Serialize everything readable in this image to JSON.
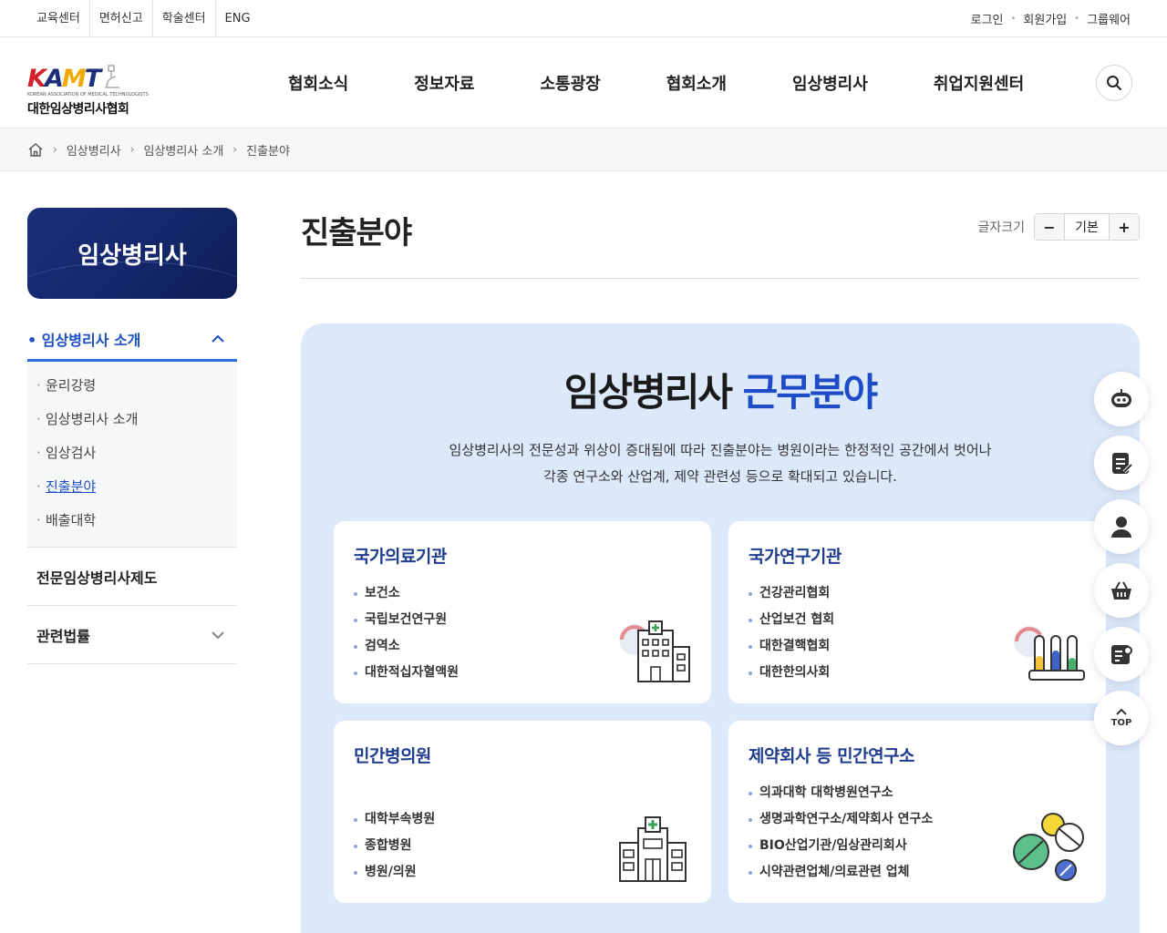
{
  "topbar": {
    "links": [
      "교육센터",
      "면허신고",
      "학술센터",
      "ENG"
    ],
    "right": [
      "로그인",
      "회원가입",
      "그룹웨어"
    ]
  },
  "logo": {
    "mark": "KAMT",
    "sub": "KOREAN ASSOCIATION OF MEDICAL TECHNOLOGISTS",
    "name": "대한임상병리사협회"
  },
  "gnb": [
    "협회소식",
    "정보자료",
    "소통광장",
    "협회소개",
    "임상병리사",
    "취업지원센터"
  ],
  "breadcrumb": [
    "임상병리사",
    "임상병리사 소개",
    "진출분야"
  ],
  "side": {
    "title": "임상병리사",
    "active": "임상병리사 소개",
    "sub": [
      "윤리강령",
      "임상병리사 소개",
      "임상검사",
      "진출분야",
      "배출대학"
    ],
    "items": [
      "전문임상병리사제도",
      "관련법률"
    ]
  },
  "main": {
    "title": "진출분야",
    "fontsize": {
      "label": "글자크기",
      "minus": "−",
      "default": "기본",
      "plus": "+"
    },
    "head_black": "임상병리사",
    "head_blue": "근무분야",
    "desc1": "임상병리사의 전문성과 위상이 증대됨에 따라 진출분야는 병원이라는 한정적인 공간에서 벗어나",
    "desc2": "각종 연구소와 산업계, 제약 관련성 등으로 확대되고 있습니다."
  },
  "cards": [
    {
      "title": "국가의료기관",
      "items": [
        "보건소",
        "국립보건연구원",
        "검역소",
        "대한적십자혈액원"
      ]
    },
    {
      "title": "국가연구기관",
      "items": [
        "건강관리협회",
        "산업보건 협회",
        "대한결핵협회",
        "대한한의사회"
      ]
    },
    {
      "title": "민간병의원",
      "items": [
        "대학부속병원",
        "종합병원",
        "병원/의원"
      ]
    },
    {
      "title": "제약회사 등 민간연구소",
      "items": [
        "의과대학 대학병원연구소",
        "생명과학연구소/제약회사 연구소",
        "BIO산업기관/임상관리회사",
        "시약관련업체/의료관련 업체"
      ]
    }
  ],
  "quick": {
    "top_label": "TOP"
  },
  "colors": {
    "brand_navy": "#15276a",
    "accent_blue": "#1e4cc8",
    "panel_bg": "#dbe9fb"
  }
}
